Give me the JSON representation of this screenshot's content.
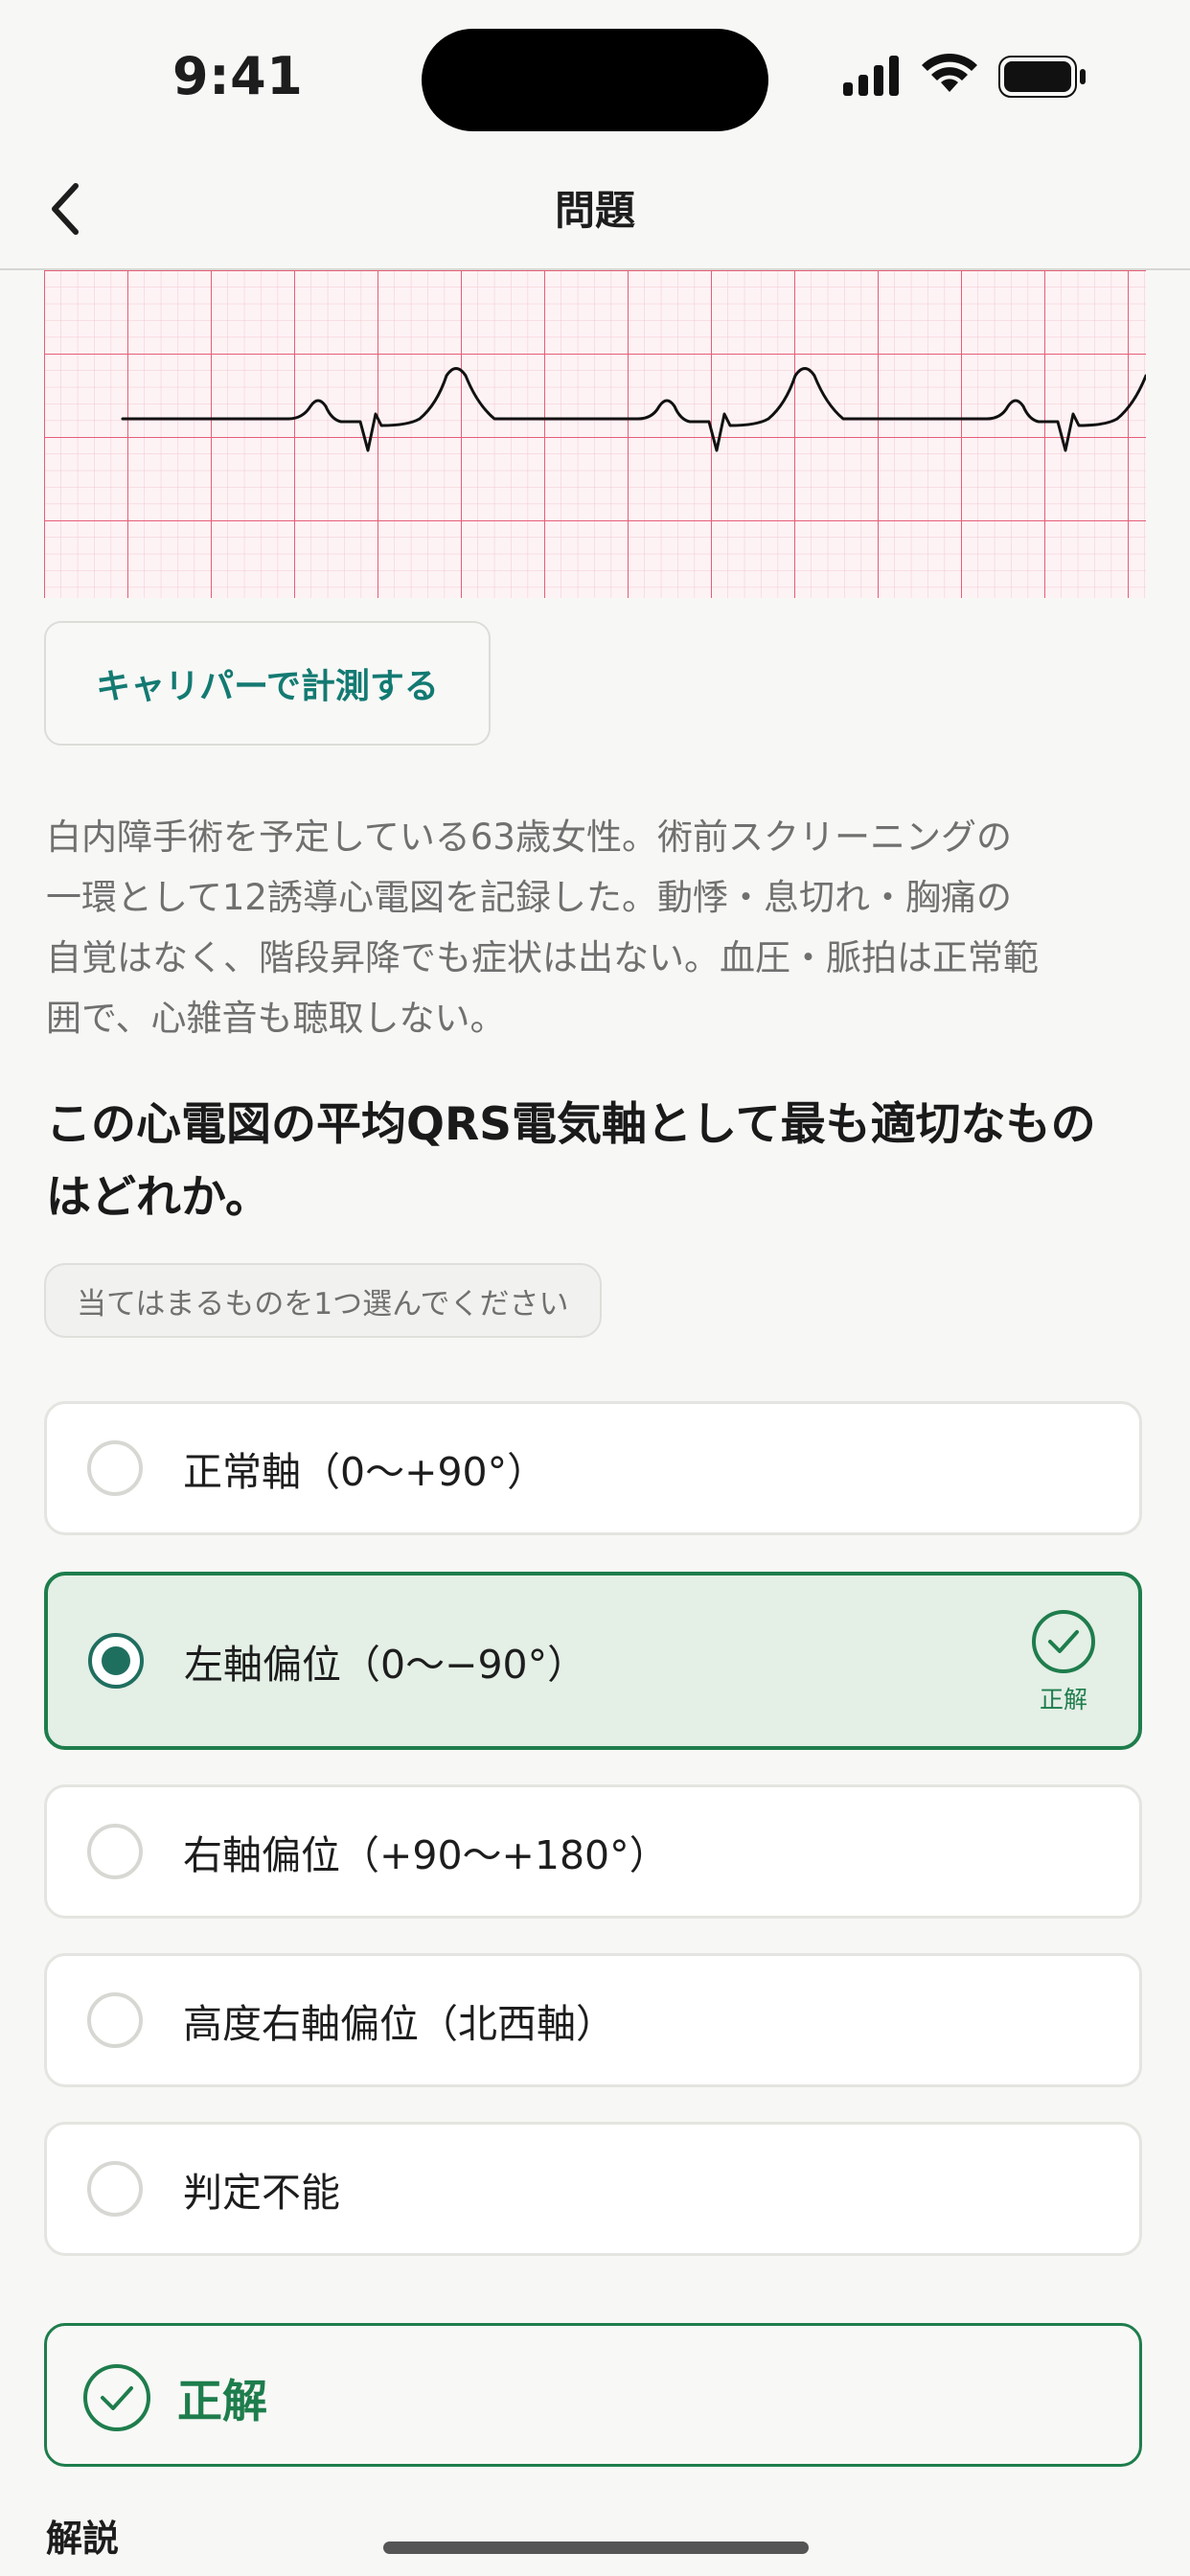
{
  "status_bar": {
    "time": "9:41"
  },
  "nav": {
    "title": "問題",
    "back_icon": "chevron-left-icon"
  },
  "ecg": {
    "grid_minor_color": "#f5c8d0",
    "grid_major_color": "#e55f77",
    "trace_color": "#111111"
  },
  "caliper_button": {
    "label": "キャリパーで計測する"
  },
  "scenario": {
    "line1": "白内障手術を予定している63歳女性。術前スクリーニングの",
    "line2": "一環として12誘導心電図を記録した。動悸・息切れ・胸痛の",
    "line3": "自覚はなく、階段昇降でも症状は出ない。血圧・脈拍は正常範",
    "line4": "囲で、心雑音も聴取しない。"
  },
  "question": {
    "line1": "この心電図の平均QRS電気軸として最も適切なもの",
    "line2": "はどれか。"
  },
  "hint": {
    "label": "当てはまるものを1つ選んでください"
  },
  "options": [
    {
      "label": "正常軸（0〜+90°）"
    },
    {
      "label": "左軸偏位（0〜−90°）",
      "selected": true,
      "correct_label": "正解"
    },
    {
      "label": "右軸偏位（+90〜+180°）"
    },
    {
      "label": "高度右軸偏位（北西軸）"
    },
    {
      "label": "判定不能"
    }
  ],
  "result": {
    "label": "正解"
  },
  "explanation": {
    "title": "解説"
  },
  "colors": {
    "accent_teal": "#137a72",
    "correct_green": "#1e7d4c",
    "selected_bg": "#e4efe6",
    "background": "#f7f7f5"
  }
}
